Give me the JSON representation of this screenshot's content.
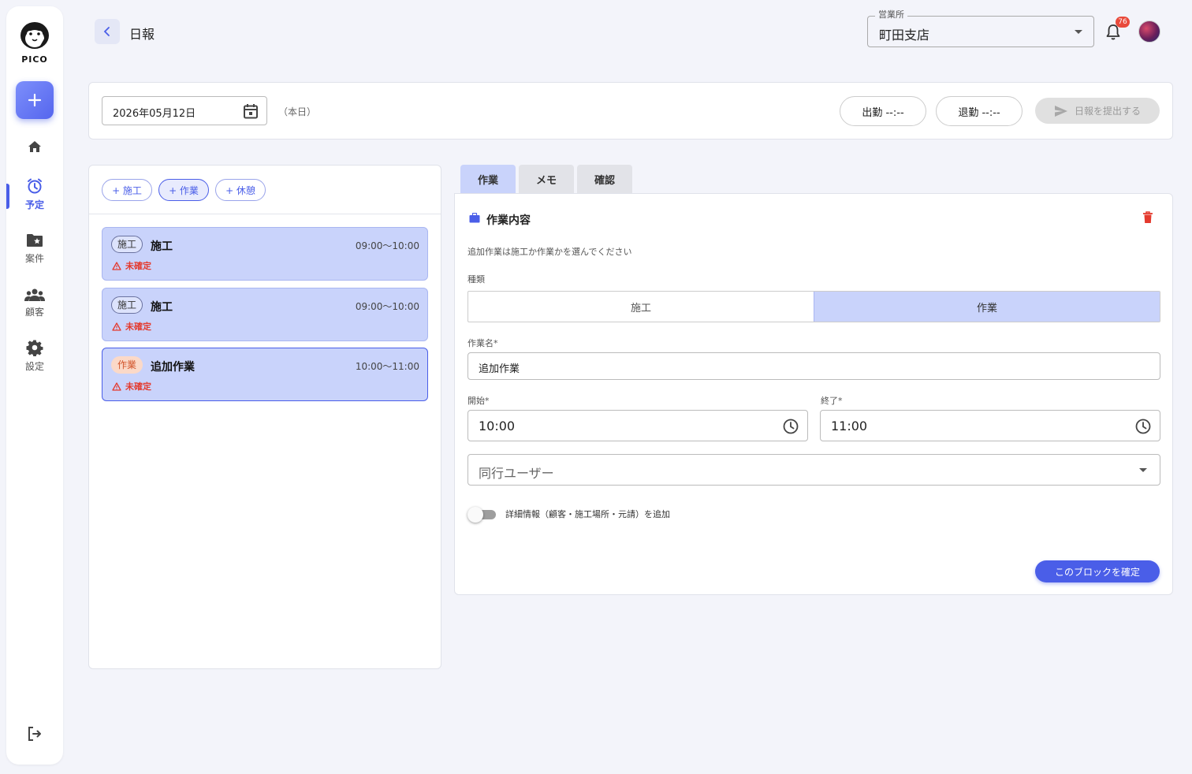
{
  "app": {
    "logo_text": "PICO"
  },
  "sidebar": {
    "items": [
      {
        "id": "home",
        "label": "",
        "icon": "home-icon"
      },
      {
        "id": "schedule",
        "label": "予定",
        "icon": "alarm-clock-icon",
        "active": true
      },
      {
        "id": "projects",
        "label": "案件",
        "icon": "folder-star-icon"
      },
      {
        "id": "customers",
        "label": "顧客",
        "icon": "people-icon"
      },
      {
        "id": "settings",
        "label": "設定",
        "icon": "gear-icon"
      }
    ],
    "logout_icon": "logout-icon"
  },
  "header": {
    "title": "日報",
    "office": {
      "label": "営業所",
      "value": "町田支店"
    },
    "notification_count": "76"
  },
  "toolbar": {
    "date": "2026年05月12日",
    "today_note": "（本日）",
    "clock_in": "出勤 --:--",
    "clock_out": "退勤 --:--",
    "submit": "日報を提出する"
  },
  "left_panel": {
    "chips": [
      "+ 施工",
      "+ 作業",
      "+ 休憩"
    ],
    "cards": [
      {
        "tag": "施工",
        "title": "施工",
        "time": "09:00〜10:00",
        "status": "未確定"
      },
      {
        "tag": "施工",
        "title": "施工",
        "time": "09:00〜10:00",
        "status": "未確定"
      },
      {
        "tag": "作業",
        "title": "追加作業",
        "time": "10:00〜11:00",
        "status": "未確定"
      }
    ]
  },
  "tabs": [
    "作業",
    "メモ",
    "確認"
  ],
  "form": {
    "section_title": "作業内容",
    "hint": "追加作業は施工か作業かを選んでください",
    "type_label": "種類",
    "type_options": [
      "施工",
      "作業"
    ],
    "type_selected": "作業",
    "name_label": "作業名*",
    "name_value": "追加作業",
    "start_label": "開始*",
    "start_value": "10:00",
    "end_label": "終了*",
    "end_value": "11:00",
    "companion_placeholder": "同行ユーザー",
    "detail_toggle_label": "詳細情報（顧客・施工場所・元請）を追加",
    "confirm_button": "このブロックを確定"
  },
  "colors": {
    "accent": "#4a5ee8",
    "selected_fill": "#c9d3fb",
    "warning": "#e43a2e"
  }
}
